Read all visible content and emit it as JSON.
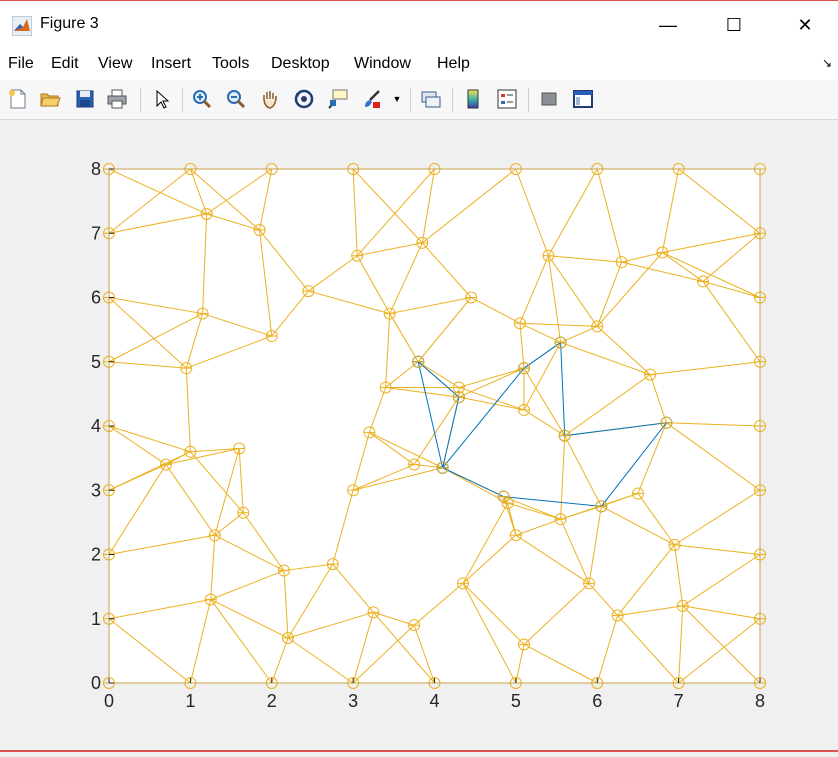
{
  "window": {
    "title": "Figure 3",
    "controls": {
      "minimize": "—",
      "maximize": "☐",
      "close": "✕"
    }
  },
  "menu": {
    "items": [
      "File",
      "Edit",
      "View",
      "Insert",
      "Tools",
      "Desktop",
      "Window",
      "Help"
    ],
    "dock_arrow": "↘"
  },
  "toolbar": {
    "tools": [
      "new-figure",
      "open-file",
      "save",
      "print",
      "edit-plot",
      "zoom-in",
      "zoom-out",
      "pan",
      "rotate-3d",
      "data-cursor",
      "brush",
      "brush-dropdown",
      "link-plot",
      "insert-colorbar",
      "insert-legend",
      "hide-plot-tools",
      "show-plot-tools"
    ]
  },
  "colors": {
    "mesh": "#EDB120",
    "path": "#0072BD",
    "axes": "#262626"
  },
  "chart_data": {
    "type": "line",
    "xlim": [
      0,
      8
    ],
    "ylim": [
      0,
      8
    ],
    "xticks": [
      "0",
      "1",
      "2",
      "3",
      "4",
      "5",
      "6",
      "7",
      "8"
    ],
    "yticks": [
      "0",
      "1",
      "2",
      "3",
      "4",
      "5",
      "6",
      "7",
      "8"
    ],
    "grid": false,
    "nodes": [
      [
        0,
        8
      ],
      [
        1,
        8
      ],
      [
        2,
        8
      ],
      [
        3,
        8
      ],
      [
        4,
        8
      ],
      [
        5,
        8
      ],
      [
        6,
        8
      ],
      [
        7,
        8
      ],
      [
        8,
        8
      ],
      [
        0,
        7
      ],
      [
        1.2,
        7.3
      ],
      [
        1.85,
        7.05
      ],
      [
        3.05,
        6.65
      ],
      [
        3.85,
        6.85
      ],
      [
        5.4,
        6.65
      ],
      [
        6.3,
        6.55
      ],
      [
        6.8,
        6.7
      ],
      [
        8,
        7
      ],
      [
        0,
        6
      ],
      [
        1.15,
        5.75
      ],
      [
        2.45,
        6.1
      ],
      [
        3.45,
        5.75
      ],
      [
        4.45,
        6
      ],
      [
        5.05,
        5.6
      ],
      [
        6,
        5.55
      ],
      [
        7.3,
        6.25
      ],
      [
        8,
        6
      ],
      [
        0,
        5
      ],
      [
        0.95,
        4.9
      ],
      [
        2,
        5.4
      ],
      [
        3.8,
        5
      ],
      [
        3.4,
        4.6
      ],
      [
        5.1,
        4.9
      ],
      [
        5.55,
        5.3
      ],
      [
        6.65,
        4.8
      ],
      [
        8,
        5
      ],
      [
        4.3,
        4.6
      ],
      [
        4.3,
        4.45
      ],
      [
        5.1,
        4.25
      ],
      [
        3.2,
        3.9
      ],
      [
        0,
        4
      ],
      [
        1,
        3.6
      ],
      [
        1.6,
        3.65
      ],
      [
        5.6,
        3.85
      ],
      [
        6.85,
        4.05
      ],
      [
        8,
        4
      ],
      [
        0.7,
        3.4
      ],
      [
        3.75,
        3.4
      ],
      [
        4.1,
        3.35
      ],
      [
        3,
        3
      ],
      [
        4.9,
        2.8
      ],
      [
        4.85,
        2.9
      ],
      [
        5.55,
        2.55
      ],
      [
        6.05,
        2.75
      ],
      [
        6.5,
        2.95
      ],
      [
        8,
        3
      ],
      [
        0,
        3
      ],
      [
        1.65,
        2.65
      ],
      [
        1.3,
        2.3
      ],
      [
        5,
        2.3
      ],
      [
        6.95,
        2.15
      ],
      [
        8,
        2
      ],
      [
        0,
        2
      ],
      [
        2.15,
        1.75
      ],
      [
        2.75,
        1.85
      ],
      [
        4.35,
        1.55
      ],
      [
        5.9,
        1.55
      ],
      [
        1.25,
        1.3
      ],
      [
        3.25,
        1.1
      ],
      [
        3.75,
        0.9
      ],
      [
        5.1,
        0.6
      ],
      [
        6.25,
        1.05
      ],
      [
        7.05,
        1.2
      ],
      [
        2.2,
        0.7
      ],
      [
        0,
        1
      ],
      [
        8,
        1
      ],
      [
        0,
        0
      ],
      [
        1,
        0
      ],
      [
        2,
        0
      ],
      [
        3,
        0
      ],
      [
        4,
        0
      ],
      [
        5,
        0
      ],
      [
        6,
        0
      ],
      [
        7,
        0
      ],
      [
        8,
        0
      ]
    ],
    "path_points": [
      [
        3.8,
        5
      ],
      [
        4.3,
        4.45
      ],
      [
        4.1,
        3.35
      ],
      [
        5.1,
        4.9
      ],
      [
        5.55,
        5.3
      ],
      [
        5.6,
        3.85
      ],
      [
        6.85,
        4.05
      ],
      [
        6.05,
        2.75
      ],
      [
        4.85,
        2.9
      ],
      [
        4.1,
        3.35
      ],
      [
        3.8,
        5
      ]
    ]
  }
}
